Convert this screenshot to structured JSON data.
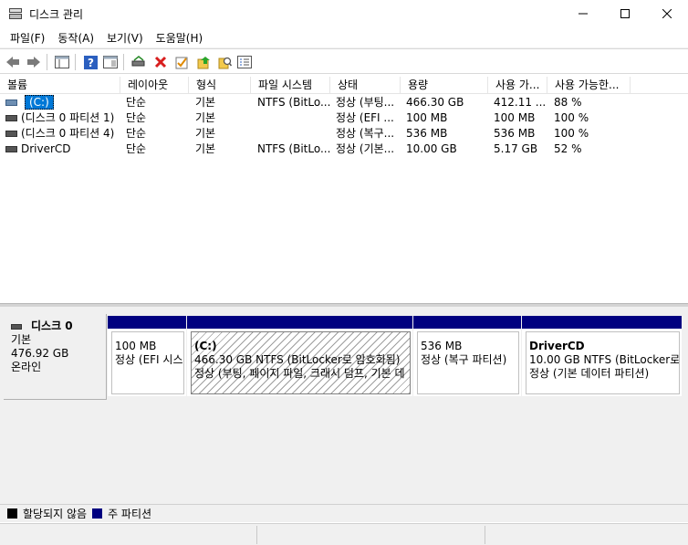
{
  "window": {
    "title": "디스크 관리"
  },
  "menu": [
    "파일(F)",
    "동작(A)",
    "보기(V)",
    "도움말(H)"
  ],
  "columns": [
    "볼륨",
    "레이아웃",
    "형식",
    "파일 시스템",
    "상태",
    "용량",
    "사용 가...",
    "사용 가능한..."
  ],
  "volumes": [
    {
      "name": "(C:)",
      "layout": "단순",
      "type": "기본",
      "fs": "NTFS (BitLo...",
      "status": "정상 (부팅...",
      "capacity": "466.30 GB",
      "free": "412.11 ...",
      "pct": "88 %"
    },
    {
      "name": "(디스크 0 파티션 1)",
      "layout": "단순",
      "type": "기본",
      "fs": "",
      "status": "정상 (EFI ...",
      "capacity": "100 MB",
      "free": "100 MB",
      "pct": "100 %"
    },
    {
      "name": "(디스크 0 파티션 4)",
      "layout": "단순",
      "type": "기본",
      "fs": "",
      "status": "정상 (복구...",
      "capacity": "536 MB",
      "free": "536 MB",
      "pct": "100 %"
    },
    {
      "name": "DriverCD",
      "layout": "단순",
      "type": "기본",
      "fs": "NTFS (BitLo...",
      "status": "정상 (기본...",
      "capacity": "10.00 GB",
      "free": "5.17 GB",
      "pct": "52 %"
    }
  ],
  "disk": {
    "name": "디스크 0",
    "type": "기본",
    "size": "476.92 GB",
    "state": "온라인"
  },
  "partitions": [
    {
      "name": "",
      "size": "100 MB",
      "status": "정상 (EFI 시스"
    },
    {
      "name": "(C:)",
      "size": "466.30 GB NTFS (BitLocker로 암호화됨)",
      "status": "정상 (부팅, 페이지 파일, 크래시 덤프, 기본 데"
    },
    {
      "name": "",
      "size": "536 MB",
      "status": "정상 (복구 파티션)"
    },
    {
      "name": "DriverCD",
      "size": "10.00 GB NTFS (BitLocker로 암호화됨)",
      "status": "정상 (기본 데이터 파티션)"
    }
  ],
  "legend": {
    "unallocated": "할당되지 않음",
    "primary": "주 파티션"
  },
  "colors": {
    "primary_partition": "#000080",
    "unallocated": "#000000",
    "selection": "#0078d7"
  },
  "icons": [
    "back-icon",
    "forward-icon",
    "console-tree-icon",
    "help-icon",
    "show-pane-icon",
    "connect-icon",
    "delete-icon",
    "check-icon",
    "refresh-icon",
    "search-icon",
    "properties-icon"
  ]
}
